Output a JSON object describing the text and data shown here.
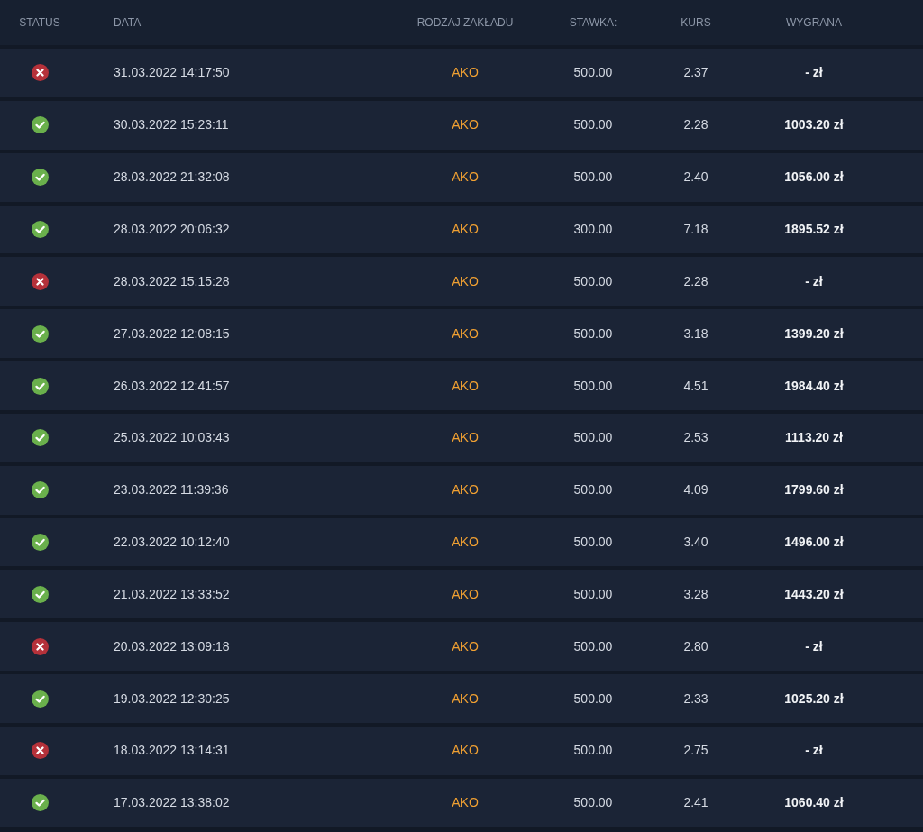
{
  "table": {
    "columns": [
      "STATUS",
      "DATA",
      "RODZAJ ZAKŁADU",
      "STAWKA:",
      "KURS",
      "WYGRANA"
    ],
    "rows": [
      {
        "won": false,
        "date": "31.03.2022 14:17:50",
        "type": "AKO",
        "stake": "500.00",
        "odds": "2.37",
        "win": "- zł"
      },
      {
        "won": true,
        "date": "30.03.2022 15:23:11",
        "type": "AKO",
        "stake": "500.00",
        "odds": "2.28",
        "win": "1003.20 zł"
      },
      {
        "won": true,
        "date": "28.03.2022 21:32:08",
        "type": "AKO",
        "stake": "500.00",
        "odds": "2.40",
        "win": "1056.00 zł"
      },
      {
        "won": true,
        "date": "28.03.2022 20:06:32",
        "type": "AKO",
        "stake": "300.00",
        "odds": "7.18",
        "win": "1895.52 zł"
      },
      {
        "won": false,
        "date": "28.03.2022 15:15:28",
        "type": "AKO",
        "stake": "500.00",
        "odds": "2.28",
        "win": "- zł"
      },
      {
        "won": true,
        "date": "27.03.2022 12:08:15",
        "type": "AKO",
        "stake": "500.00",
        "odds": "3.18",
        "win": "1399.20 zł"
      },
      {
        "won": true,
        "date": "26.03.2022 12:41:57",
        "type": "AKO",
        "stake": "500.00",
        "odds": "4.51",
        "win": "1984.40 zł"
      },
      {
        "won": true,
        "date": "25.03.2022 10:03:43",
        "type": "AKO",
        "stake": "500.00",
        "odds": "2.53",
        "win": "1113.20 zł"
      },
      {
        "won": true,
        "date": "23.03.2022 11:39:36",
        "type": "AKO",
        "stake": "500.00",
        "odds": "4.09",
        "win": "1799.60 zł"
      },
      {
        "won": true,
        "date": "22.03.2022 10:12:40",
        "type": "AKO",
        "stake": "500.00",
        "odds": "3.40",
        "win": "1496.00 zł"
      },
      {
        "won": true,
        "date": "21.03.2022 13:33:52",
        "type": "AKO",
        "stake": "500.00",
        "odds": "3.28",
        "win": "1443.20 zł"
      },
      {
        "won": false,
        "date": "20.03.2022 13:09:18",
        "type": "AKO",
        "stake": "500.00",
        "odds": "2.80",
        "win": "- zł"
      },
      {
        "won": true,
        "date": "19.03.2022 12:30:25",
        "type": "AKO",
        "stake": "500.00",
        "odds": "2.33",
        "win": "1025.20 zł"
      },
      {
        "won": false,
        "date": "18.03.2022 13:14:31",
        "type": "AKO",
        "stake": "500.00",
        "odds": "2.75",
        "win": "- zł"
      },
      {
        "won": true,
        "date": "17.03.2022 13:38:02",
        "type": "AKO",
        "stake": "500.00",
        "odds": "2.41",
        "win": "1060.40 zł"
      }
    ]
  }
}
